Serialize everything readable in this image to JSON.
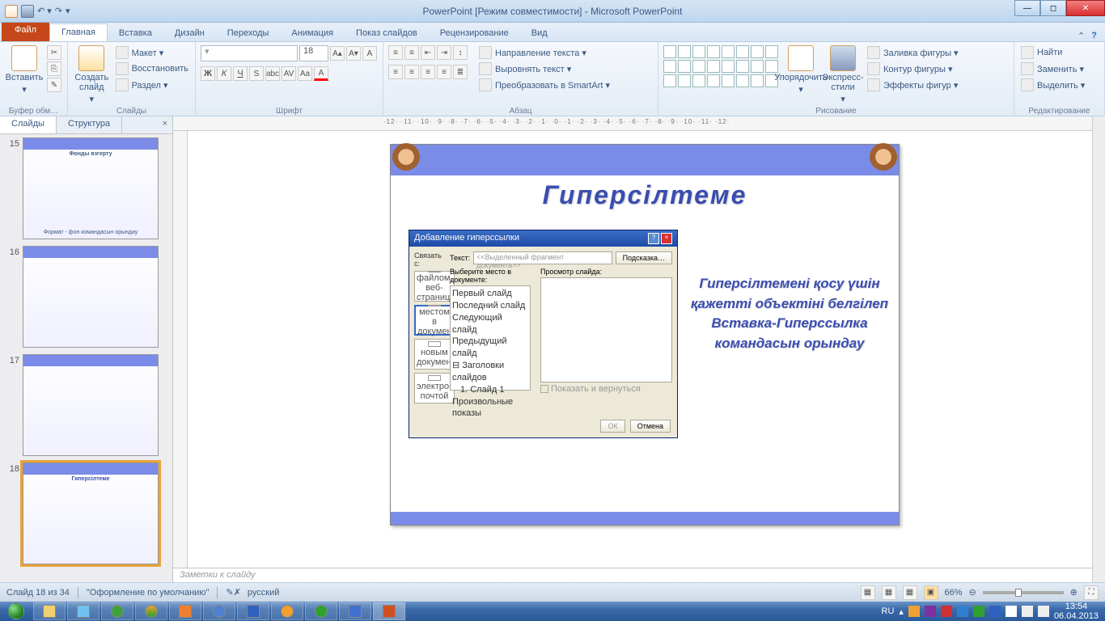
{
  "title": "PowerPoint [Режим совместимости]  -  Microsoft PowerPoint",
  "tabs": {
    "file": "Файл",
    "home": "Главная",
    "insert": "Вставка",
    "design": "Дизайн",
    "transitions": "Переходы",
    "animation": "Анимация",
    "slideshow": "Показ слайдов",
    "review": "Рецензирование",
    "view": "Вид"
  },
  "groups": {
    "clipboard": "Буфер обм…",
    "slides": "Слайды",
    "font": "Шрифт",
    "paragraph": "Абзац",
    "drawing": "Рисование",
    "editing": "Редактирование"
  },
  "clipboard": {
    "paste": "Вставить"
  },
  "slides_grp": {
    "new": "Создать слайд",
    "layout": "Макет ▾",
    "reset": "Восстановить",
    "section": "Раздел ▾"
  },
  "font": {
    "size": "18"
  },
  "paragraph": {
    "direction": "Направление текста ▾",
    "align": "Выровнять текст ▾",
    "smartart": "Преобразовать в SmartArt ▾"
  },
  "drawing": {
    "arrange": "Упорядочить",
    "styles": "Экспресс-стили",
    "fill": "Заливка фигуры ▾",
    "outline": "Контур фигуры ▾",
    "effects": "Эффекты фигур ▾"
  },
  "editing": {
    "find": "Найти",
    "replace": "Заменить ▾",
    "select": "Выделить ▾"
  },
  "panel": {
    "slides": "Слайды",
    "outline": "Структура"
  },
  "thumbs": {
    "n15": "15",
    "n16": "16",
    "n17": "17",
    "n18": "18",
    "t15a": "Фонды өзгерту",
    "t15b": "Формат - фон командасын орындау",
    "t18": "Гиперсілтеме"
  },
  "ruler": "·12·  ·11·  ·10·  ·9·  ·8·  ·7·  ·6·  ·5·  ·4·  ·3·  ·2·  ·1·  ·0·  ·1·  ·2·  ·3·  ·4·  ·5·  ·6·  ·7·  ·8·  ·9·  ·10·  ·11·  ·12·",
  "slide": {
    "title": "Гиперсілтеме",
    "text": "Гиперсілтемені қосу үшін қажетті объектіні белгілеп Вставка-Гиперссылка командасын орындау"
  },
  "dlg": {
    "title": "Добавление гиперссылки",
    "link_with": "Связать с:",
    "text_lbl": "Текст:",
    "text_val": "<<Выделенный фрагмент документа>>",
    "tooltip": "Подсказка…",
    "select": "Выберите место в документе:",
    "preview": "Просмотр слайда:",
    "side": {
      "web": "файлом, веб-страницей",
      "doc": "местом в документе",
      "new": "новым документом",
      "mail": "электронной почтой"
    },
    "tree": {
      "first": "Первый слайд",
      "last": "Последний слайд",
      "next": "Следующий слайд",
      "prev": "Предыдущий слайд",
      "headers": "⊟ Заголовки слайдов",
      "s1": "1. Слайд 1",
      "custom": "Произвольные показы"
    },
    "showreturn": "Показать и вернуться",
    "ok": "ОК",
    "cancel": "Отмена"
  },
  "notes": "Заметки к слайду",
  "status": {
    "slide": "Слайд 18 из 34",
    "theme": "\"Оформление по умолчанию\"",
    "lang": "русский",
    "zoom": "66%"
  },
  "tray": {
    "lang": "RU",
    "time": "13:54",
    "date": "06.04.2013"
  }
}
